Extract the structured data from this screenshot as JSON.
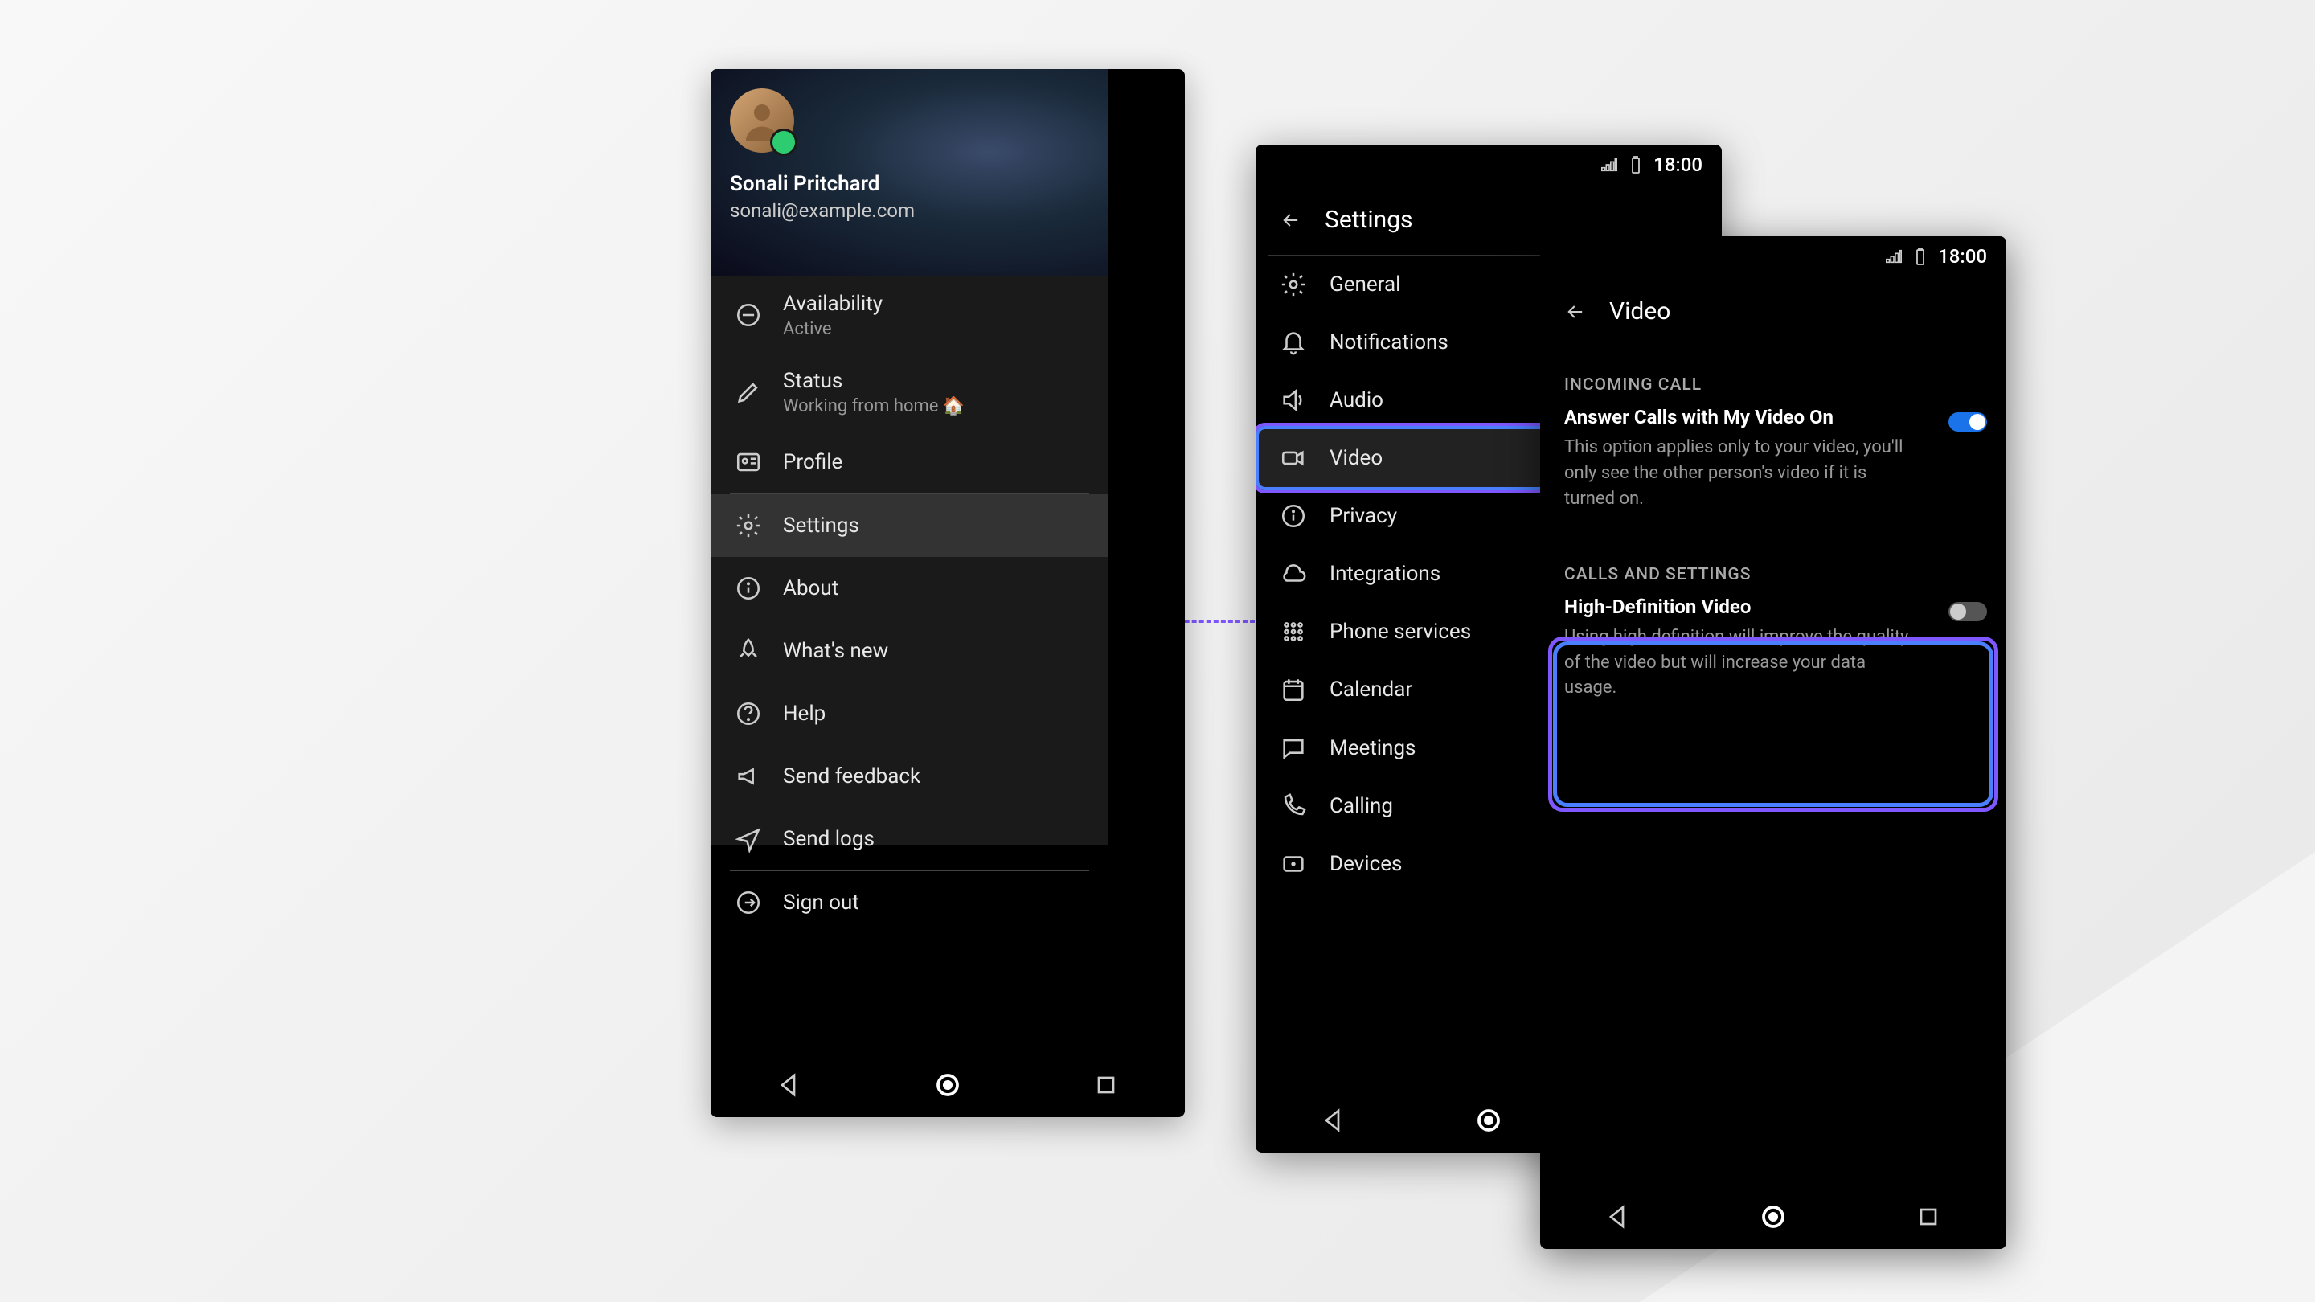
{
  "profile": {
    "name": "Sonali Pritchard",
    "email": "sonali@example.com"
  },
  "drawer": {
    "availability": {
      "label": "Availability",
      "value": "Active"
    },
    "status": {
      "label": "Status",
      "value": "Working from home 🏠"
    },
    "profile": "Profile",
    "settings": "Settings",
    "about": "About",
    "whatsnew": "What's new",
    "help": "Help",
    "feedback": "Send feedback",
    "logs": "Send logs",
    "signout": "Sign out"
  },
  "statusbar": {
    "time": "18:00"
  },
  "settings": {
    "title": "Settings",
    "items": {
      "general": "General",
      "notifications": "Notifications",
      "audio": "Audio",
      "video": "Video",
      "privacy": "Privacy",
      "integrations": "Integrations",
      "phoneservices": "Phone services",
      "calendar": "Calendar",
      "meetings": "Meetings",
      "calling": "Calling",
      "devices": "Devices"
    }
  },
  "video": {
    "title": "Video",
    "section1": "INCOMING CALL",
    "answer": {
      "title": "Answer Calls with My Video On",
      "desc": "This option applies only to your video, you'll only see the other person's video if it is turned on.",
      "enabled": true
    },
    "section2": "CALLS AND SETTINGS",
    "hd": {
      "title": "High-Definition Video",
      "desc": "Using high definition will improve the quality of the video but will increase your data usage.",
      "enabled": false
    }
  }
}
